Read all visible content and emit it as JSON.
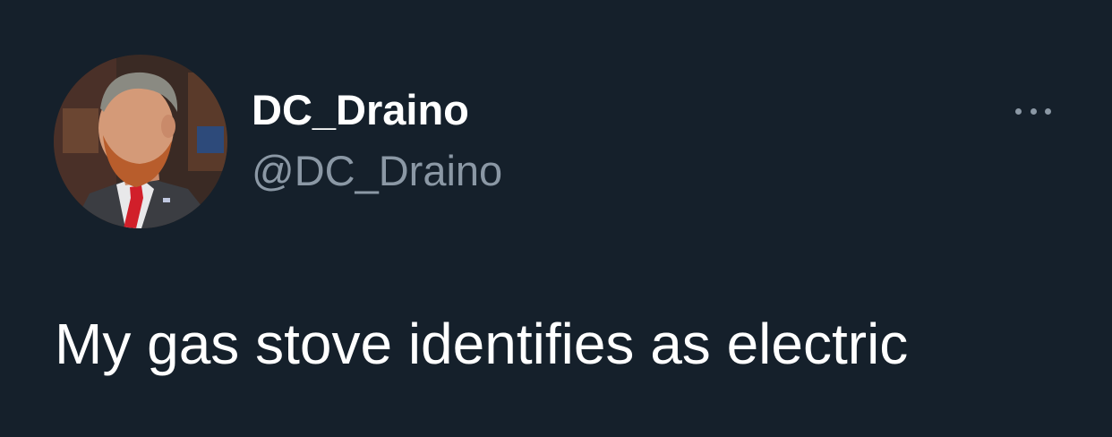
{
  "tweet": {
    "display_name": "DC_Draino",
    "handle": "@DC_Draino",
    "text": "My gas stove identifies as electric",
    "more_icon": "more-horizontal-icon",
    "avatar_description": "profile-photo"
  },
  "colors": {
    "background": "#15202b",
    "primary_text": "#ffffff",
    "secondary_text": "#8b98a5"
  }
}
